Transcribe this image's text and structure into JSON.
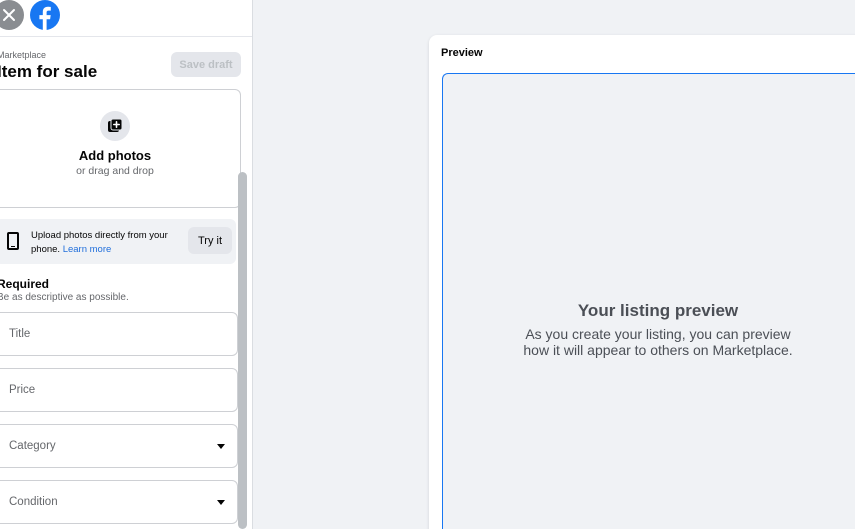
{
  "header": {
    "breadcrumb": "Marketplace",
    "title": "Item for sale",
    "save_draft_label": "Save draft"
  },
  "photos": {
    "add_label": "Add photos",
    "drag_label": "or drag and drop"
  },
  "upload_banner": {
    "text": "Upload photos directly from your phone.",
    "learn_more": "Learn more",
    "try_it_label": "Try it"
  },
  "required_section": {
    "heading": "Required",
    "subtext": "Be as descriptive as possible."
  },
  "fields": {
    "title": "Title",
    "price": "Price",
    "category": "Category",
    "condition": "Condition"
  },
  "preview": {
    "heading": "Preview",
    "title": "Your listing preview",
    "description_line1": "As you create your listing, you can preview",
    "description_line2": "how it will appear to others on Marketplace."
  },
  "colors": {
    "accent": "#1877f2",
    "link": "#216fdb",
    "background": "#f0f2f5"
  },
  "icons": {
    "close": "close-icon",
    "logo": "facebook-logo-icon",
    "add_photo": "add-photo-icon",
    "phone": "phone-icon",
    "dropdown": "caret-down-icon"
  }
}
